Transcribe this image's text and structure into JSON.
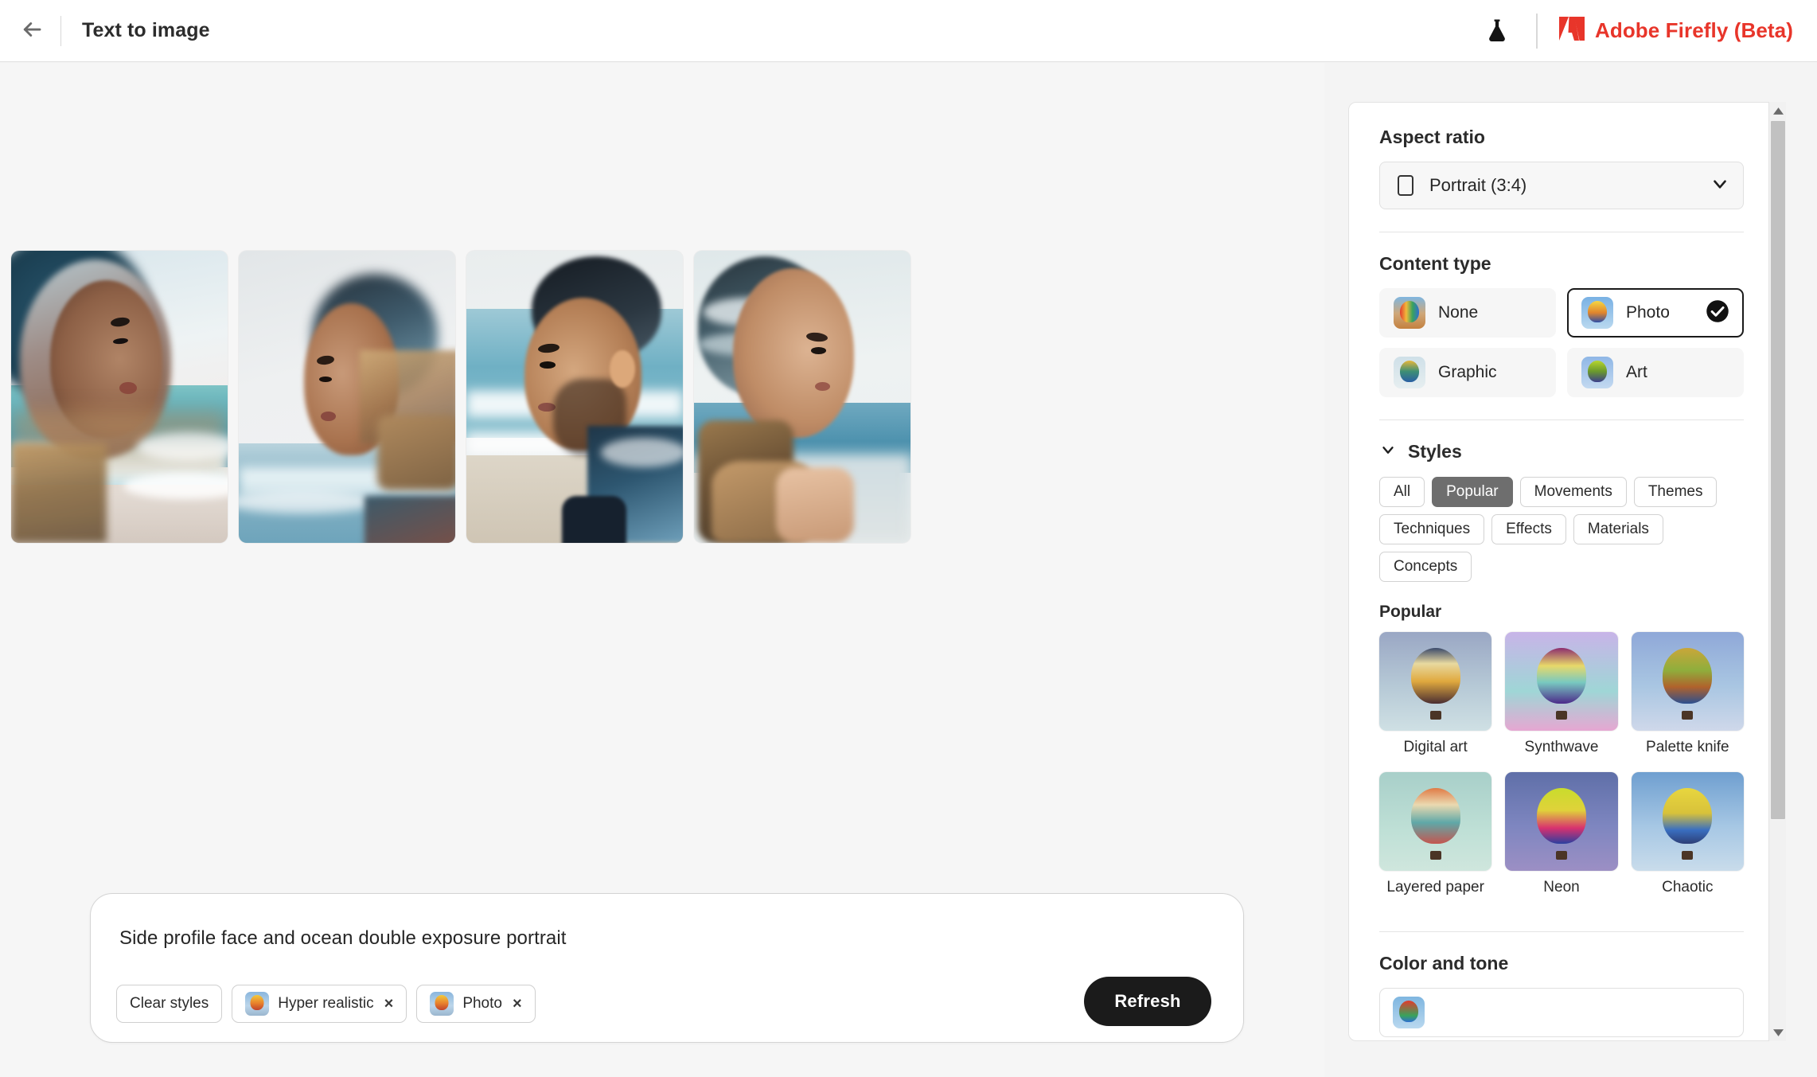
{
  "header": {
    "back_icon": "arrow-left-icon",
    "title": "Text to image",
    "flask_icon": "flask-icon",
    "brand": "Adobe Firefly (Beta)",
    "brand_color": "#e8352a"
  },
  "results": [
    {
      "alt": "Side profile woman with ocean double exposure, teal waves"
    },
    {
      "alt": "Side profile woman with beach and rocks double exposure, light background"
    },
    {
      "alt": "Side profile man with ocean waves double exposure"
    },
    {
      "alt": "Side profile woman with clouds and shoreline double exposure"
    }
  ],
  "prompt": {
    "text": "Side profile face and ocean double exposure portrait",
    "clear_styles_label": "Clear styles",
    "chips": [
      {
        "label": "Hyper realistic",
        "remove": "×"
      },
      {
        "label": "Photo",
        "remove": "×"
      }
    ],
    "refresh_label": "Refresh"
  },
  "panel": {
    "aspect_ratio": {
      "title": "Aspect ratio",
      "value": "Portrait (3:4)",
      "icon": "portrait-rect-icon",
      "chevron": "chevron-down-icon"
    },
    "content_type": {
      "title": "Content type",
      "options": [
        {
          "label": "None",
          "selected": false
        },
        {
          "label": "Photo",
          "selected": true
        },
        {
          "label": "Graphic",
          "selected": false
        },
        {
          "label": "Art",
          "selected": false
        }
      ],
      "check_icon": "check-circle-icon"
    },
    "styles": {
      "title": "Styles",
      "collapse_icon": "chevron-down-icon",
      "filters": [
        {
          "label": "All",
          "active": false
        },
        {
          "label": "Popular",
          "active": true
        },
        {
          "label": "Movements",
          "active": false
        },
        {
          "label": "Themes",
          "active": false
        },
        {
          "label": "Techniques",
          "active": false
        },
        {
          "label": "Effects",
          "active": false
        },
        {
          "label": "Materials",
          "active": false
        },
        {
          "label": "Concepts",
          "active": false
        }
      ],
      "group_title": "Popular",
      "items": [
        {
          "label": "Digital art"
        },
        {
          "label": "Synthwave"
        },
        {
          "label": "Palette knife"
        },
        {
          "label": "Layered paper"
        },
        {
          "label": "Neon"
        },
        {
          "label": "Chaotic"
        }
      ]
    },
    "color_and_tone": {
      "title": "Color and tone"
    },
    "scrollbar": {
      "up_icon": "caret-up-icon",
      "down_icon": "caret-down-icon"
    }
  }
}
